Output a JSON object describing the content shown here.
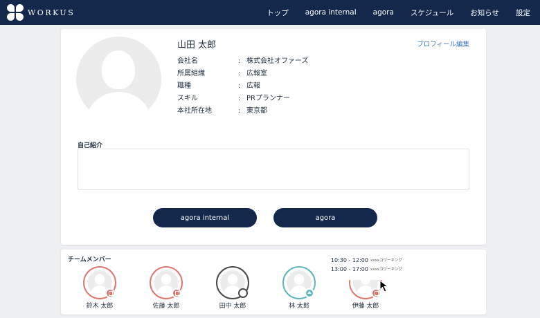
{
  "brand": {
    "name": "WORKUS"
  },
  "nav": [
    "トップ",
    "agora internal",
    "agora",
    "スケジュール",
    "お知らせ",
    "設定"
  ],
  "profile": {
    "name": "山田 太郎",
    "edit_label": "プロフィール編集",
    "fields": [
      {
        "label": "会社名",
        "value": "株式会社オファーズ"
      },
      {
        "label": "所属組織",
        "value": "広報室"
      },
      {
        "label": "職種",
        "value": "広報"
      },
      {
        "label": "スキル",
        "value": "PRプランナー"
      },
      {
        "label": "本社所在地",
        "value": "東京都"
      }
    ],
    "intro_label": "自己紹介",
    "intro_text": ""
  },
  "buttons": {
    "agora_internal": "agora internal",
    "agora": "agora"
  },
  "team": {
    "title": "チームメンバー",
    "members": [
      {
        "name": "鈴木 太郎",
        "status": "office"
      },
      {
        "name": "佐藤 太郎",
        "status": "office"
      },
      {
        "name": "田中 太郎",
        "status": "offline"
      },
      {
        "name": "林 太郎",
        "status": "home"
      },
      {
        "name": "伊藤 太郎",
        "status": "office"
      }
    ],
    "tooltip": [
      {
        "time": "10:30 - 12:00",
        "place": "xxxxコワーキング"
      },
      {
        "time": "13:00 - 17:00",
        "place": "xxxxコワーキング"
      }
    ]
  },
  "colors": {
    "nav_bg": "#13284b",
    "office": "#e0776e",
    "offline": "#4a4a4a",
    "home": "#5bb8bd",
    "link": "#3f76b9"
  }
}
